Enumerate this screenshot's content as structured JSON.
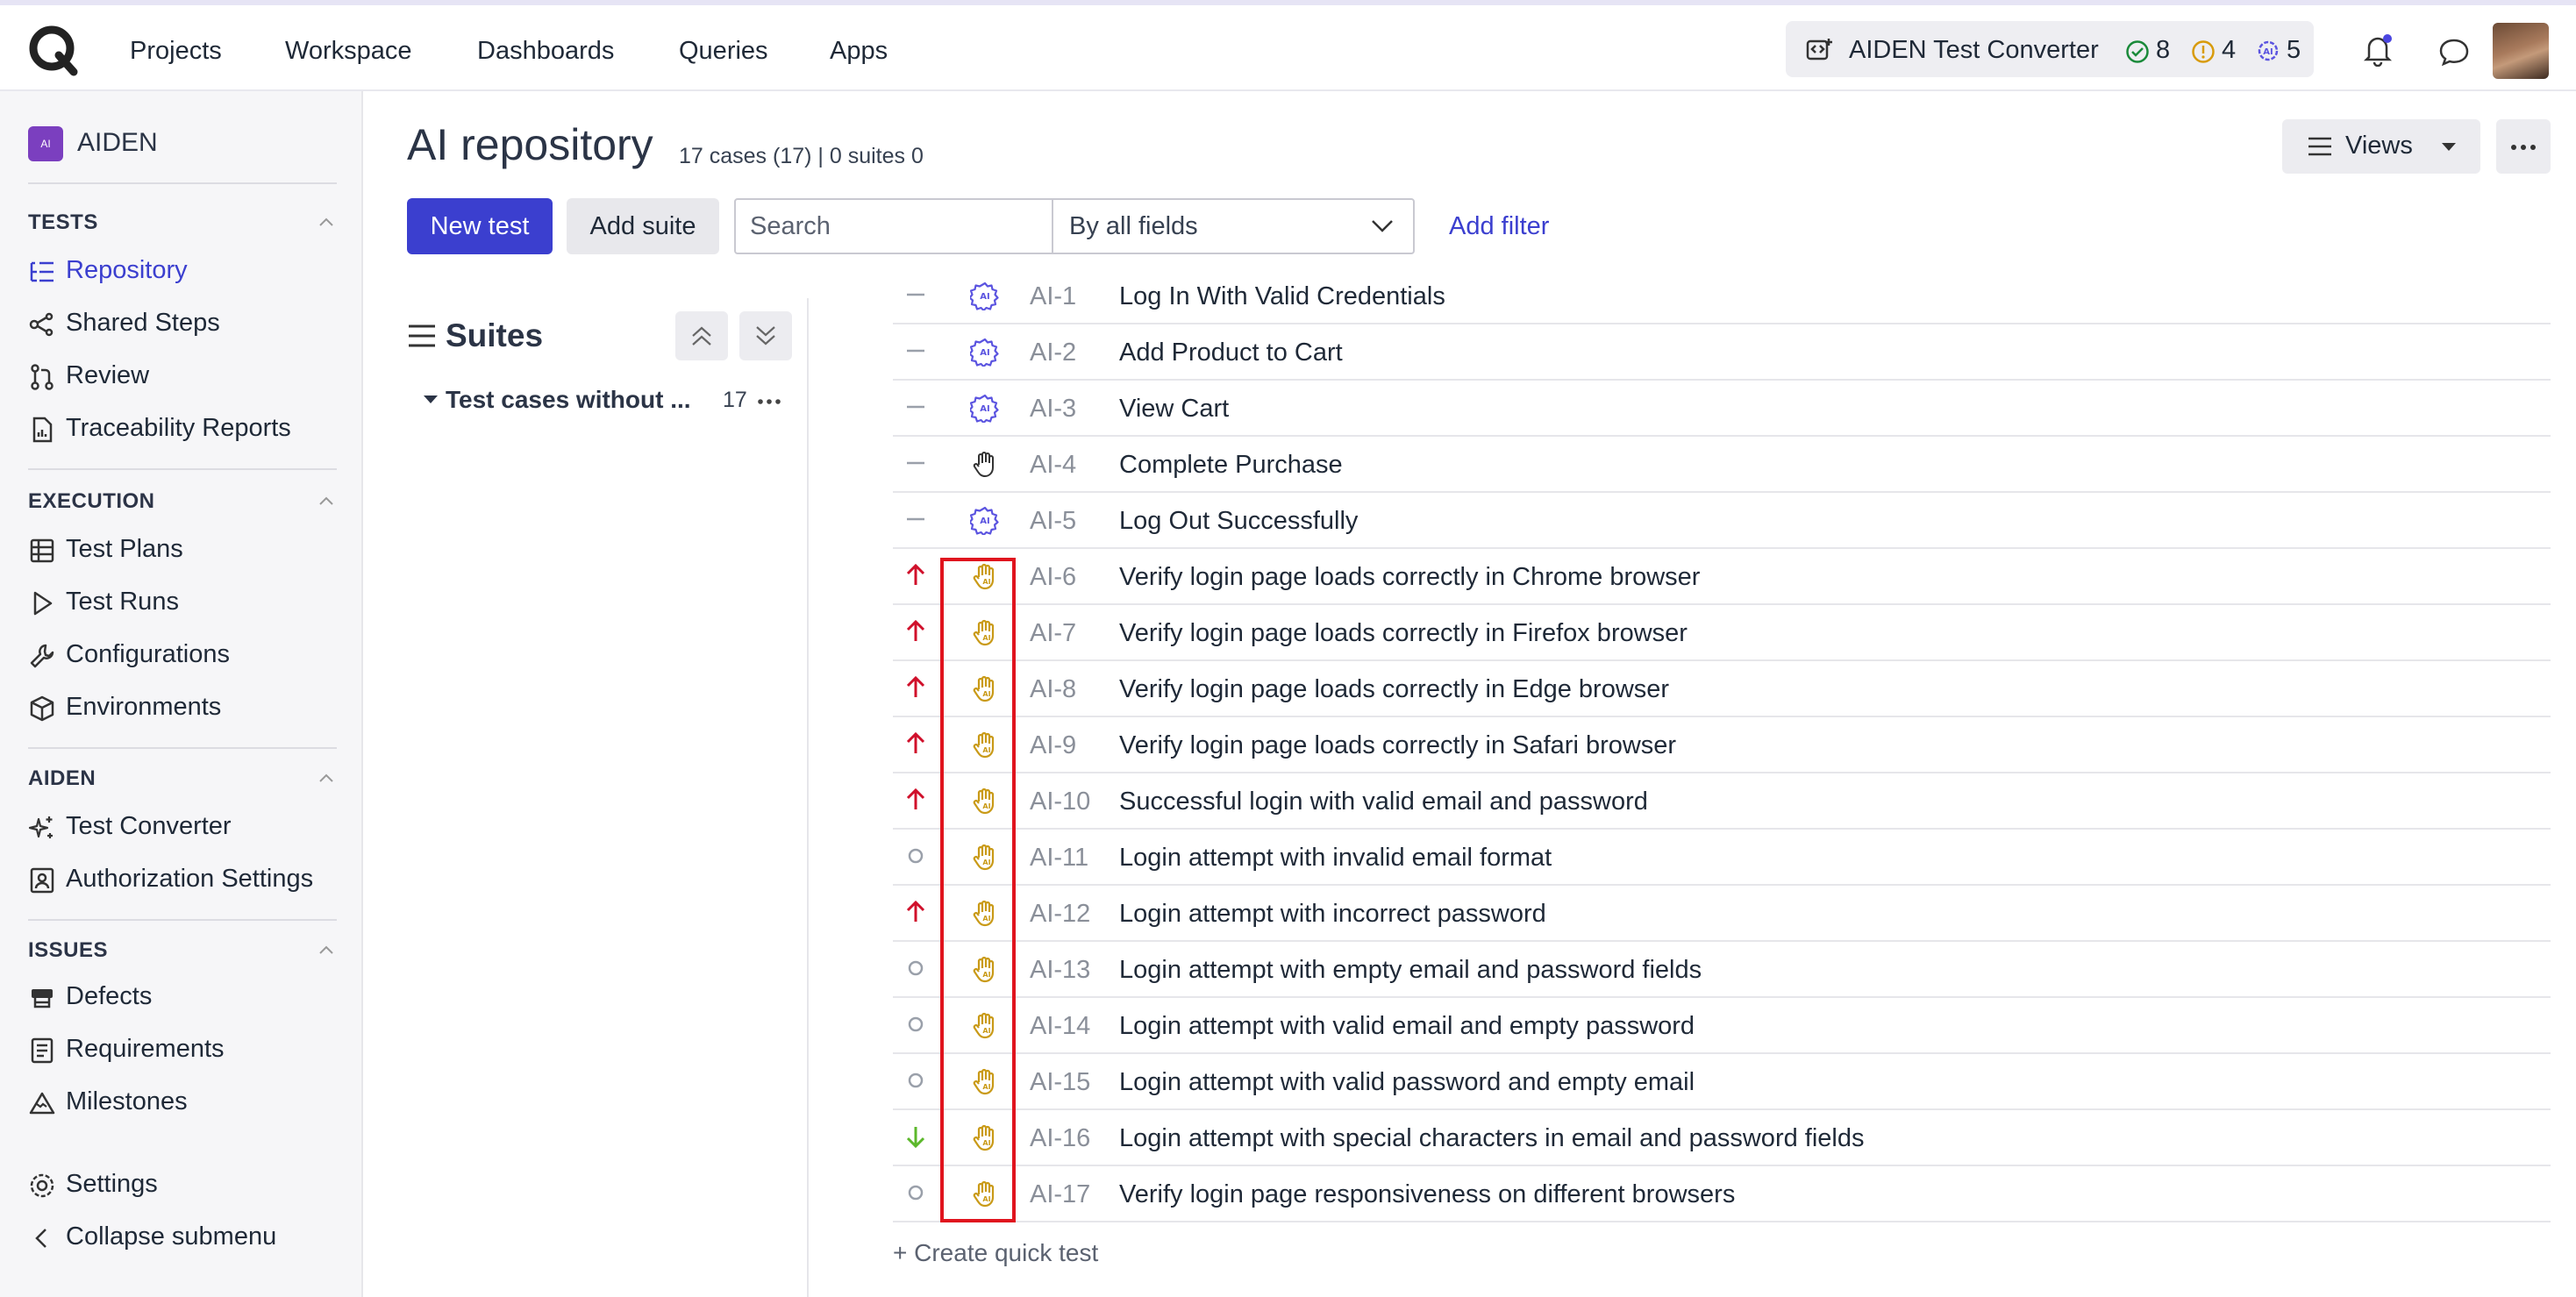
{
  "topnav": {
    "items": [
      "Projects",
      "Workspace",
      "Dashboards",
      "Queries",
      "Apps"
    ],
    "converter_label": "AIDEN Test Converter",
    "count_passed": "8",
    "count_warn": "4",
    "count_ai": "5"
  },
  "sidebar": {
    "project": "AIDEN",
    "project_badge": "AI",
    "sections": {
      "tests": "TESTS",
      "execution": "EXECUTION",
      "aiden": "AIDEN",
      "issues": "ISSUES"
    },
    "tests_items": [
      "Repository",
      "Shared Steps",
      "Review",
      "Traceability Reports"
    ],
    "execution_items": [
      "Test Plans",
      "Test Runs",
      "Configurations",
      "Environments"
    ],
    "aiden_items": [
      "Test Converter",
      "Authorization Settings"
    ],
    "issues_items": [
      "Defects",
      "Requirements",
      "Milestones"
    ],
    "settings": "Settings",
    "collapse": "Collapse submenu"
  },
  "main": {
    "title": "AI repository",
    "subtitle": "17 cases (17) | 0 suites 0",
    "new_test": "New test",
    "add_suite": "Add suite",
    "search_placeholder": "Search",
    "field_select": "By all fields",
    "add_filter": "Add filter",
    "views": "Views"
  },
  "suites": {
    "title": "Suites",
    "node_label": "Test cases without ...",
    "node_count": "17"
  },
  "cases": [
    {
      "id": "AI-1",
      "title": "Log In With Valid Credentials",
      "priority": "none",
      "type": "ai"
    },
    {
      "id": "AI-2",
      "title": "Add Product to Cart",
      "priority": "none",
      "type": "ai"
    },
    {
      "id": "AI-3",
      "title": "View Cart",
      "priority": "none",
      "type": "ai"
    },
    {
      "id": "AI-4",
      "title": "Complete Purchase",
      "priority": "none",
      "type": "manual"
    },
    {
      "id": "AI-5",
      "title": "Log Out Successfully",
      "priority": "none",
      "type": "ai"
    },
    {
      "id": "AI-6",
      "title": "Verify login page loads correctly in Chrome browser",
      "priority": "high",
      "type": "ai-manual"
    },
    {
      "id": "AI-7",
      "title": "Verify login page loads correctly in Firefox browser",
      "priority": "high",
      "type": "ai-manual"
    },
    {
      "id": "AI-8",
      "title": "Verify login page loads correctly in Edge browser",
      "priority": "high",
      "type": "ai-manual"
    },
    {
      "id": "AI-9",
      "title": "Verify login page loads correctly in Safari browser",
      "priority": "high",
      "type": "ai-manual"
    },
    {
      "id": "AI-10",
      "title": "Successful login with valid email and password",
      "priority": "high",
      "type": "ai-manual"
    },
    {
      "id": "AI-11",
      "title": "Login attempt with invalid email format",
      "priority": "normal",
      "type": "ai-manual"
    },
    {
      "id": "AI-12",
      "title": "Login attempt with incorrect password",
      "priority": "high",
      "type": "ai-manual"
    },
    {
      "id": "AI-13",
      "title": "Login attempt with empty email and password fields",
      "priority": "normal",
      "type": "ai-manual"
    },
    {
      "id": "AI-14",
      "title": "Login attempt with valid email and empty password",
      "priority": "normal",
      "type": "ai-manual"
    },
    {
      "id": "AI-15",
      "title": "Login attempt with valid password and empty email",
      "priority": "normal",
      "type": "ai-manual"
    },
    {
      "id": "AI-16",
      "title": "Login attempt with special characters in email and password fields",
      "priority": "low",
      "type": "ai-manual"
    },
    {
      "id": "AI-17",
      "title": "Verify login page responsiveness on different browsers",
      "priority": "normal",
      "type": "ai-manual"
    }
  ],
  "create_quick": "+ Create quick test",
  "colors": {
    "accent": "#3b3fcf",
    "priority_high": "#d0102b",
    "priority_low": "#5cb82c",
    "ai_icon": "#5b54e0",
    "manual_ai_icon": "#c99a17",
    "highlight": "#e0141e"
  }
}
